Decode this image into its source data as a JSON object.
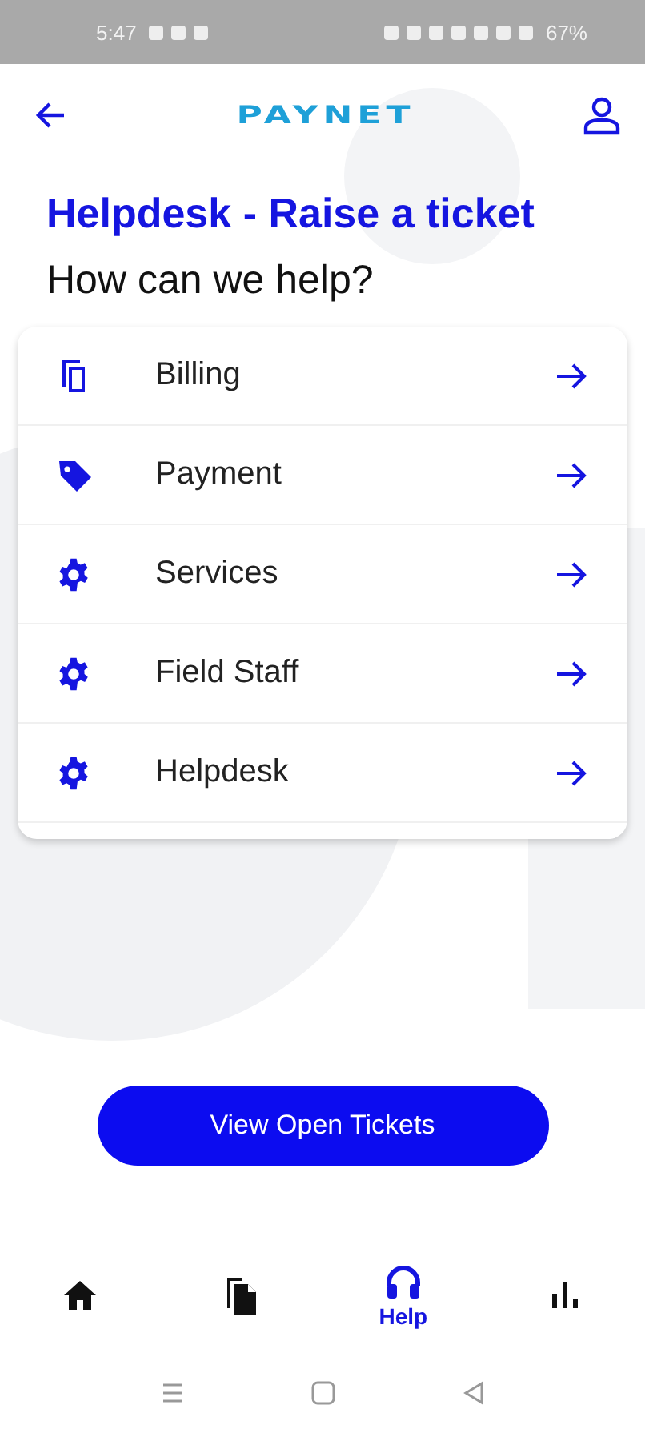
{
  "status_bar": {
    "time": "5:47",
    "battery": "67%"
  },
  "header": {
    "logo": "PAYNET"
  },
  "title": "Helpdesk - Raise a ticket",
  "subtitle": "How can we help?",
  "categories": [
    {
      "label": "Billing",
      "kind": "copy"
    },
    {
      "label": "Payment",
      "kind": "tag"
    },
    {
      "label": "Services",
      "kind": "gear"
    },
    {
      "label": "Field Staff",
      "kind": "gear"
    },
    {
      "label": "Helpdesk",
      "kind": "gear"
    }
  ],
  "action_button": "View Open Tickets",
  "bottom_nav": [
    {
      "kind": "home",
      "selected": false
    },
    {
      "kind": "documents",
      "selected": false
    },
    {
      "kind": "help",
      "label": "Help",
      "selected": true
    },
    {
      "kind": "stats",
      "selected": false
    }
  ]
}
